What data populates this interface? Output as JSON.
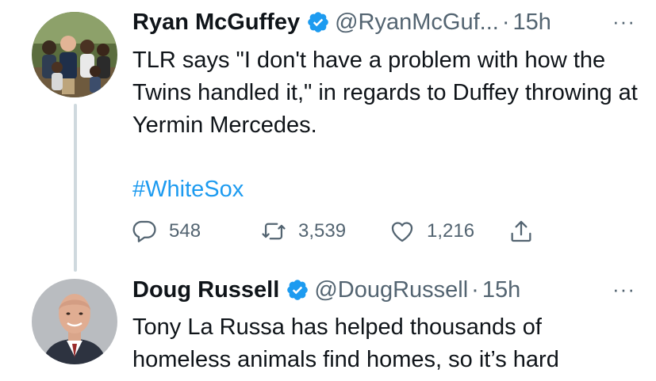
{
  "tweets": [
    {
      "display_name": "Ryan McGuffey",
      "handle": "@RyanMcGuf...",
      "separator": "·",
      "time": "15h",
      "more": "···",
      "text": "TLR says \"I don't have a problem with how the Twins handled it,\" in regards to Duffey throwing at Yermin Mercedes.",
      "hashtag": "#WhiteSox",
      "actions": {
        "reply_count": "548",
        "retweet_count": "3,539",
        "like_count": "1,216"
      }
    },
    {
      "display_name": "Doug Russell",
      "handle": "@DougRussell",
      "separator": "·",
      "time": "15h",
      "more": "···",
      "text": "Tony La Russa has helped thousands of homeless animals find homes, so it’s hard"
    }
  ],
  "colors": {
    "text": "#0f1419",
    "secondary": "#536471",
    "link": "#1d9bf0",
    "verified": "#1d9bf0",
    "thread_line": "#cfd9de"
  },
  "icons": [
    "verified-badge-icon",
    "more-icon",
    "reply-icon",
    "retweet-icon",
    "like-icon",
    "share-icon"
  ]
}
